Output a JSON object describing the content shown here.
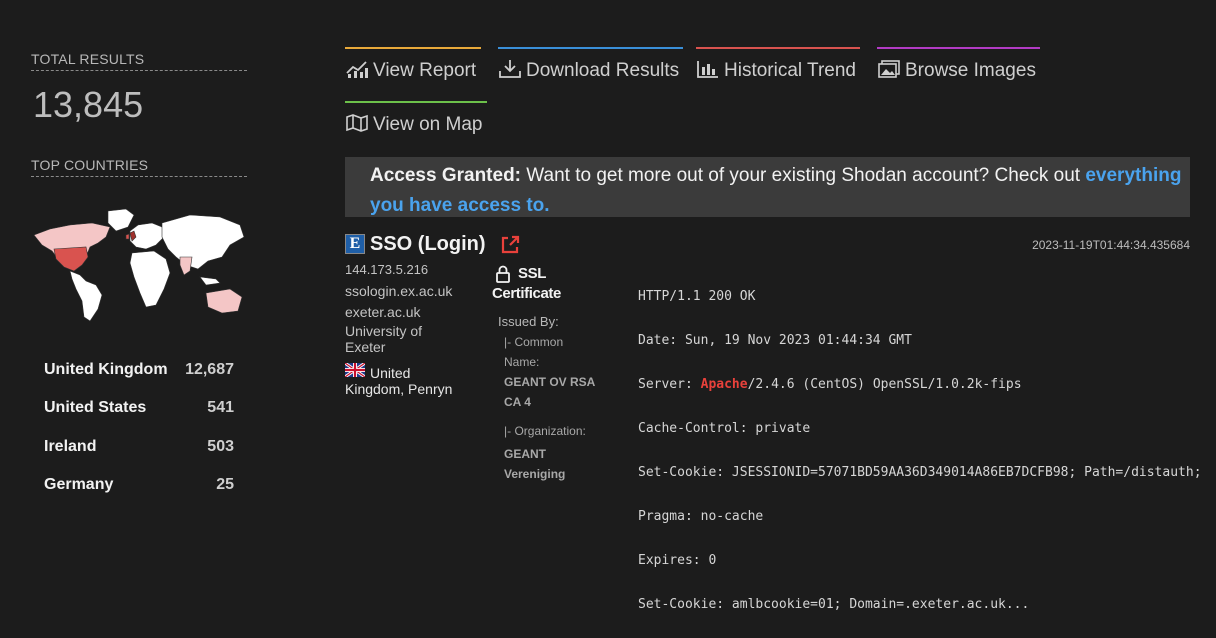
{
  "sidebar": {
    "total_label": "TOTAL RESULTS",
    "total_value": "13,845",
    "countries_label": "TOP COUNTRIES",
    "countries": [
      {
        "name": "United Kingdom",
        "count": "12,687"
      },
      {
        "name": "United States",
        "count": "541"
      },
      {
        "name": "Ireland",
        "count": "503"
      },
      {
        "name": "Germany",
        "count": "25"
      }
    ]
  },
  "tabs": [
    {
      "label": "View Report",
      "color": "#e8a93a",
      "icon": "chart-icon"
    },
    {
      "label": "Download Results",
      "color": "#3a8fd8",
      "icon": "download-icon"
    },
    {
      "label": "Historical Trend",
      "color": "#d9534f",
      "icon": "bar-chart-icon"
    },
    {
      "label": "Browse Images",
      "color": "#b23bc4",
      "icon": "images-icon"
    },
    {
      "label": "View on Map",
      "color": "#6cc04a",
      "icon": "map-icon"
    }
  ],
  "banner": {
    "strong": "Access Granted:",
    "text": " Want to get more out of your existing Shodan account? Check out ",
    "link": "everything you have access to."
  },
  "result": {
    "favicon_letter": "E",
    "title": "SSO (Login)",
    "timestamp": "2023-11-19T01:44:34.435684",
    "ip": "144.173.5.216",
    "hostname1": "ssologin.ex.ac.uk",
    "hostname2": "exeter.ac.uk",
    "org": "University of Exeter",
    "location": "United Kingdom, Penryn",
    "ssl": {
      "title": "SSL Certificate",
      "issued_by": "Issued By:",
      "common_name_label": "|- Common Name:",
      "common_name": "GEANT OV RSA CA 4",
      "org_label": "|- Organization:",
      "org": "GEANT Vereniging"
    },
    "http": [
      "HTTP/1.1 200 OK",
      "Date: Sun, 19 Nov 2023 01:44:34 GMT",
      "Server: ",
      "Cache-Control: private",
      "Set-Cookie: JSESSIONID=57071BD59AA36D349014A86EB7DCFB98; Path=/distauth;",
      "Pragma: no-cache",
      "Expires: 0",
      "Set-Cookie: amlbcookie=01; Domain=.exeter.ac.uk..."
    ],
    "server_name": "Apache",
    "server_rest": "/2.4.6 (CentOS) OpenSSL/1.0.2k-fips",
    "server_color": "#e8413b"
  }
}
